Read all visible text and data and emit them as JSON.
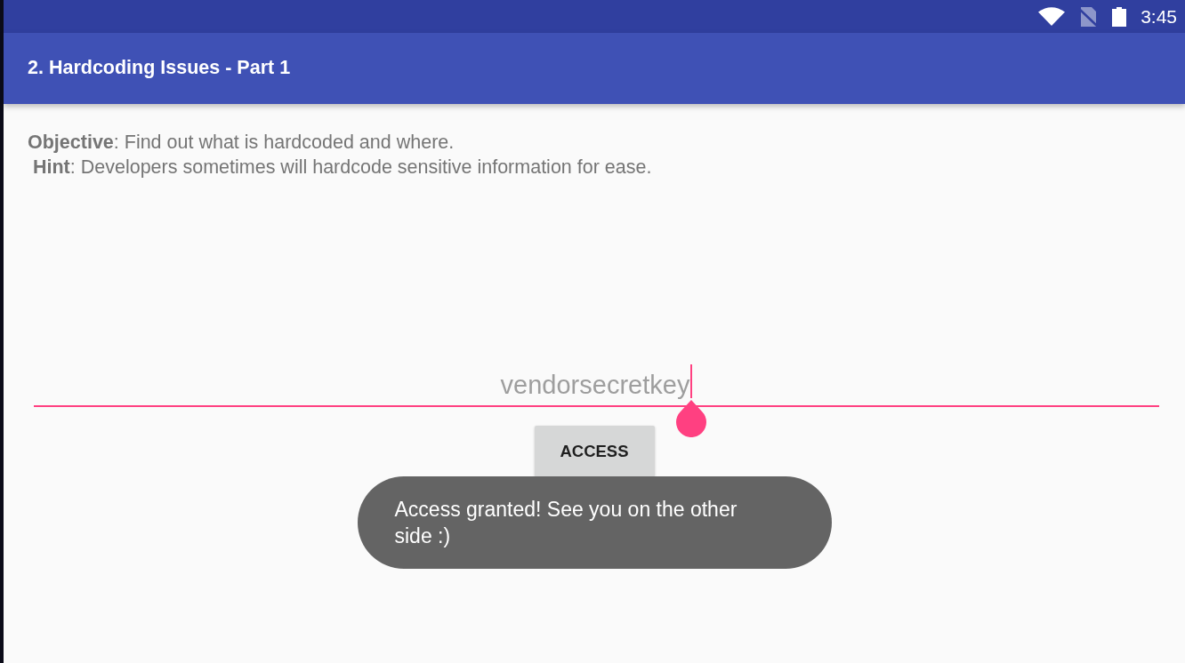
{
  "status_bar": {
    "time": "3:45"
  },
  "app_bar": {
    "title": "2. Hardcoding Issues - Part 1"
  },
  "description": [
    "**Objective**: Find out what is hardcoded and where.",
    " **Hint**: Developers sometimes will hardcode sensitive information for ease."
  ],
  "input": {
    "value": "vendorsecretkey",
    "focused": true
  },
  "button": {
    "label": "ACCESS"
  },
  "toast": {
    "message": "Access granted! See you on the other side :)"
  }
}
